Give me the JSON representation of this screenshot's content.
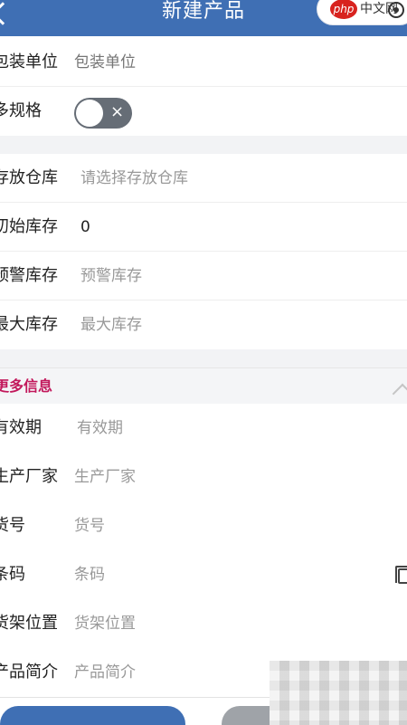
{
  "header": {
    "title": "新建产品",
    "logo_badge": "php",
    "logo_text": "中文网"
  },
  "form": {
    "package_unit": {
      "label": "包装单位",
      "placeholder": "包装单位"
    },
    "multi_spec": {
      "label": "多规格",
      "toggle_on": false,
      "toggle_off_symbol": "×"
    },
    "warehouse": {
      "label": "存放仓库",
      "placeholder": "请选择存放仓库"
    },
    "initial_stock": {
      "label": "初始库存",
      "value": "0"
    },
    "warning_stock": {
      "label": "预警库存",
      "placeholder": "预警库存"
    },
    "max_stock": {
      "label": "最大库存",
      "placeholder": "最大库存"
    }
  },
  "more_info": {
    "title": "更多信息",
    "expanded": true,
    "fields": [
      {
        "label": "有效期",
        "placeholder": "有效期"
      },
      {
        "label": "生产厂家",
        "placeholder": "生产厂家"
      },
      {
        "label": "货号",
        "placeholder": "货号"
      },
      {
        "label": "条码",
        "placeholder": "条码"
      },
      {
        "label": "货架位置",
        "placeholder": "货架位置"
      },
      {
        "label": "产品简介",
        "placeholder": "产品简介"
      }
    ]
  },
  "colors": {
    "primary": "#3f6fb4",
    "accent_title": "#c2185b"
  }
}
